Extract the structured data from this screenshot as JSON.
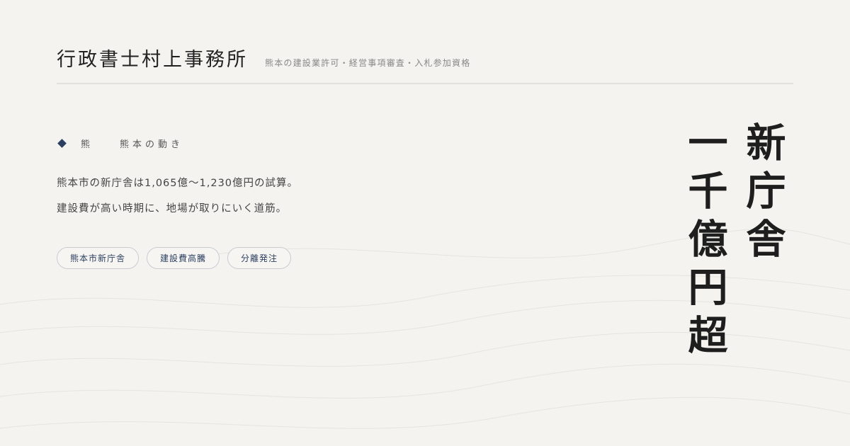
{
  "header": {
    "brand": "行政書士村上事務所",
    "tagline": "熊本の建設業許可・経営事項審査・入札参加資格"
  },
  "category": {
    "icon": "diamond-icon",
    "short_label": "熊",
    "label": "熊本の動き"
  },
  "body": {
    "line1": "熊本市の新庁舎は1,065億〜1,230億円の試算。",
    "line2": "建設費が高い時期に、地場が取りにいく道筋。"
  },
  "tags": [
    {
      "label": "熊本市新庁舎"
    },
    {
      "label": "建設費高騰"
    },
    {
      "label": "分離発注"
    }
  ],
  "headline": {
    "column1": "新庁舎",
    "column2": "一千億円超"
  },
  "colors": {
    "background": "#f4f3ef",
    "accent": "#2b3f61",
    "text": "#1e1e1e"
  }
}
